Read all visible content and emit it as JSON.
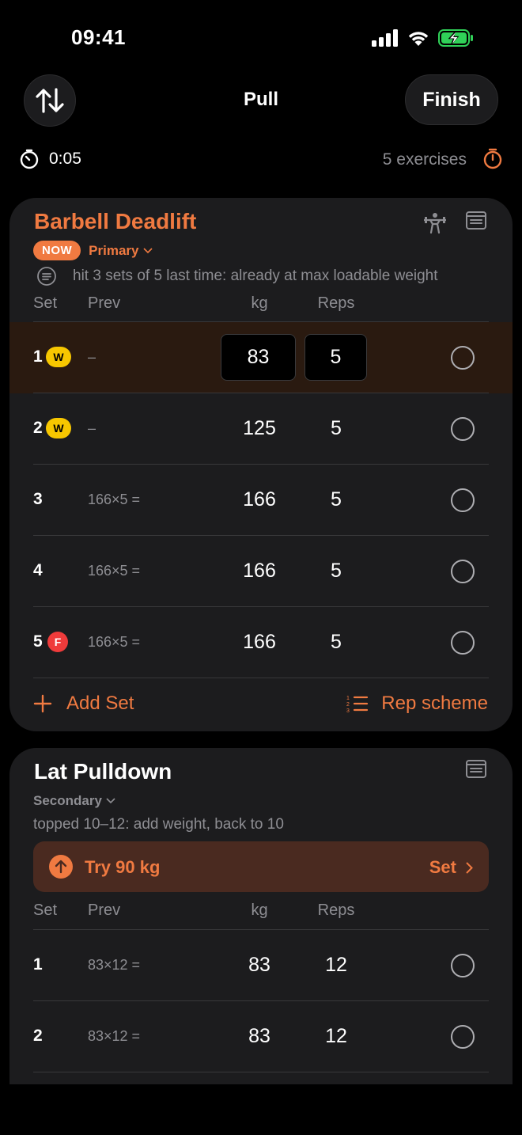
{
  "status": {
    "time": "09:41"
  },
  "header": {
    "title": "Pull",
    "finish_label": "Finish"
  },
  "subheader": {
    "elapsed": "0:05",
    "exercise_count": "5 exercises"
  },
  "colors": {
    "accent": "#f07a41",
    "warmup_badge": "#f7c700",
    "failure_badge": "#ef3b3b",
    "card_bg": "#1c1c1e"
  },
  "exercise1": {
    "name": "Barbell Deadlift",
    "now_label": "NOW",
    "role": "Primary",
    "note": "hit 3 sets of 5 last time: already at max loadable weight",
    "columns": {
      "set": "Set",
      "prev": "Prev",
      "kg": "kg",
      "reps": "Reps"
    },
    "sets": [
      {
        "num": "1",
        "badge": "W",
        "prev": "–",
        "kg": "83",
        "reps": "5"
      },
      {
        "num": "2",
        "badge": "W",
        "prev": "–",
        "kg": "125",
        "reps": "5"
      },
      {
        "num": "3",
        "badge": "",
        "prev": "166×5 =",
        "kg": "166",
        "reps": "5"
      },
      {
        "num": "4",
        "badge": "",
        "prev": "166×5 =",
        "kg": "166",
        "reps": "5"
      },
      {
        "num": "5",
        "badge": "F",
        "prev": "166×5 =",
        "kg": "166",
        "reps": "5"
      }
    ],
    "add_set_label": "Add Set",
    "rep_scheme_label": "Rep scheme"
  },
  "exercise2": {
    "name": "Lat Pulldown",
    "role": "Secondary",
    "hint": "topped 10–12: add weight, back to 10",
    "suggestion": {
      "text": "Try 90 kg",
      "action": "Set"
    },
    "columns": {
      "set": "Set",
      "prev": "Prev",
      "kg": "kg",
      "reps": "Reps"
    },
    "sets": [
      {
        "num": "1",
        "prev": "83×12 =",
        "kg": "83",
        "reps": "12"
      },
      {
        "num": "2",
        "prev": "83×12 =",
        "kg": "83",
        "reps": "12"
      }
    ]
  }
}
